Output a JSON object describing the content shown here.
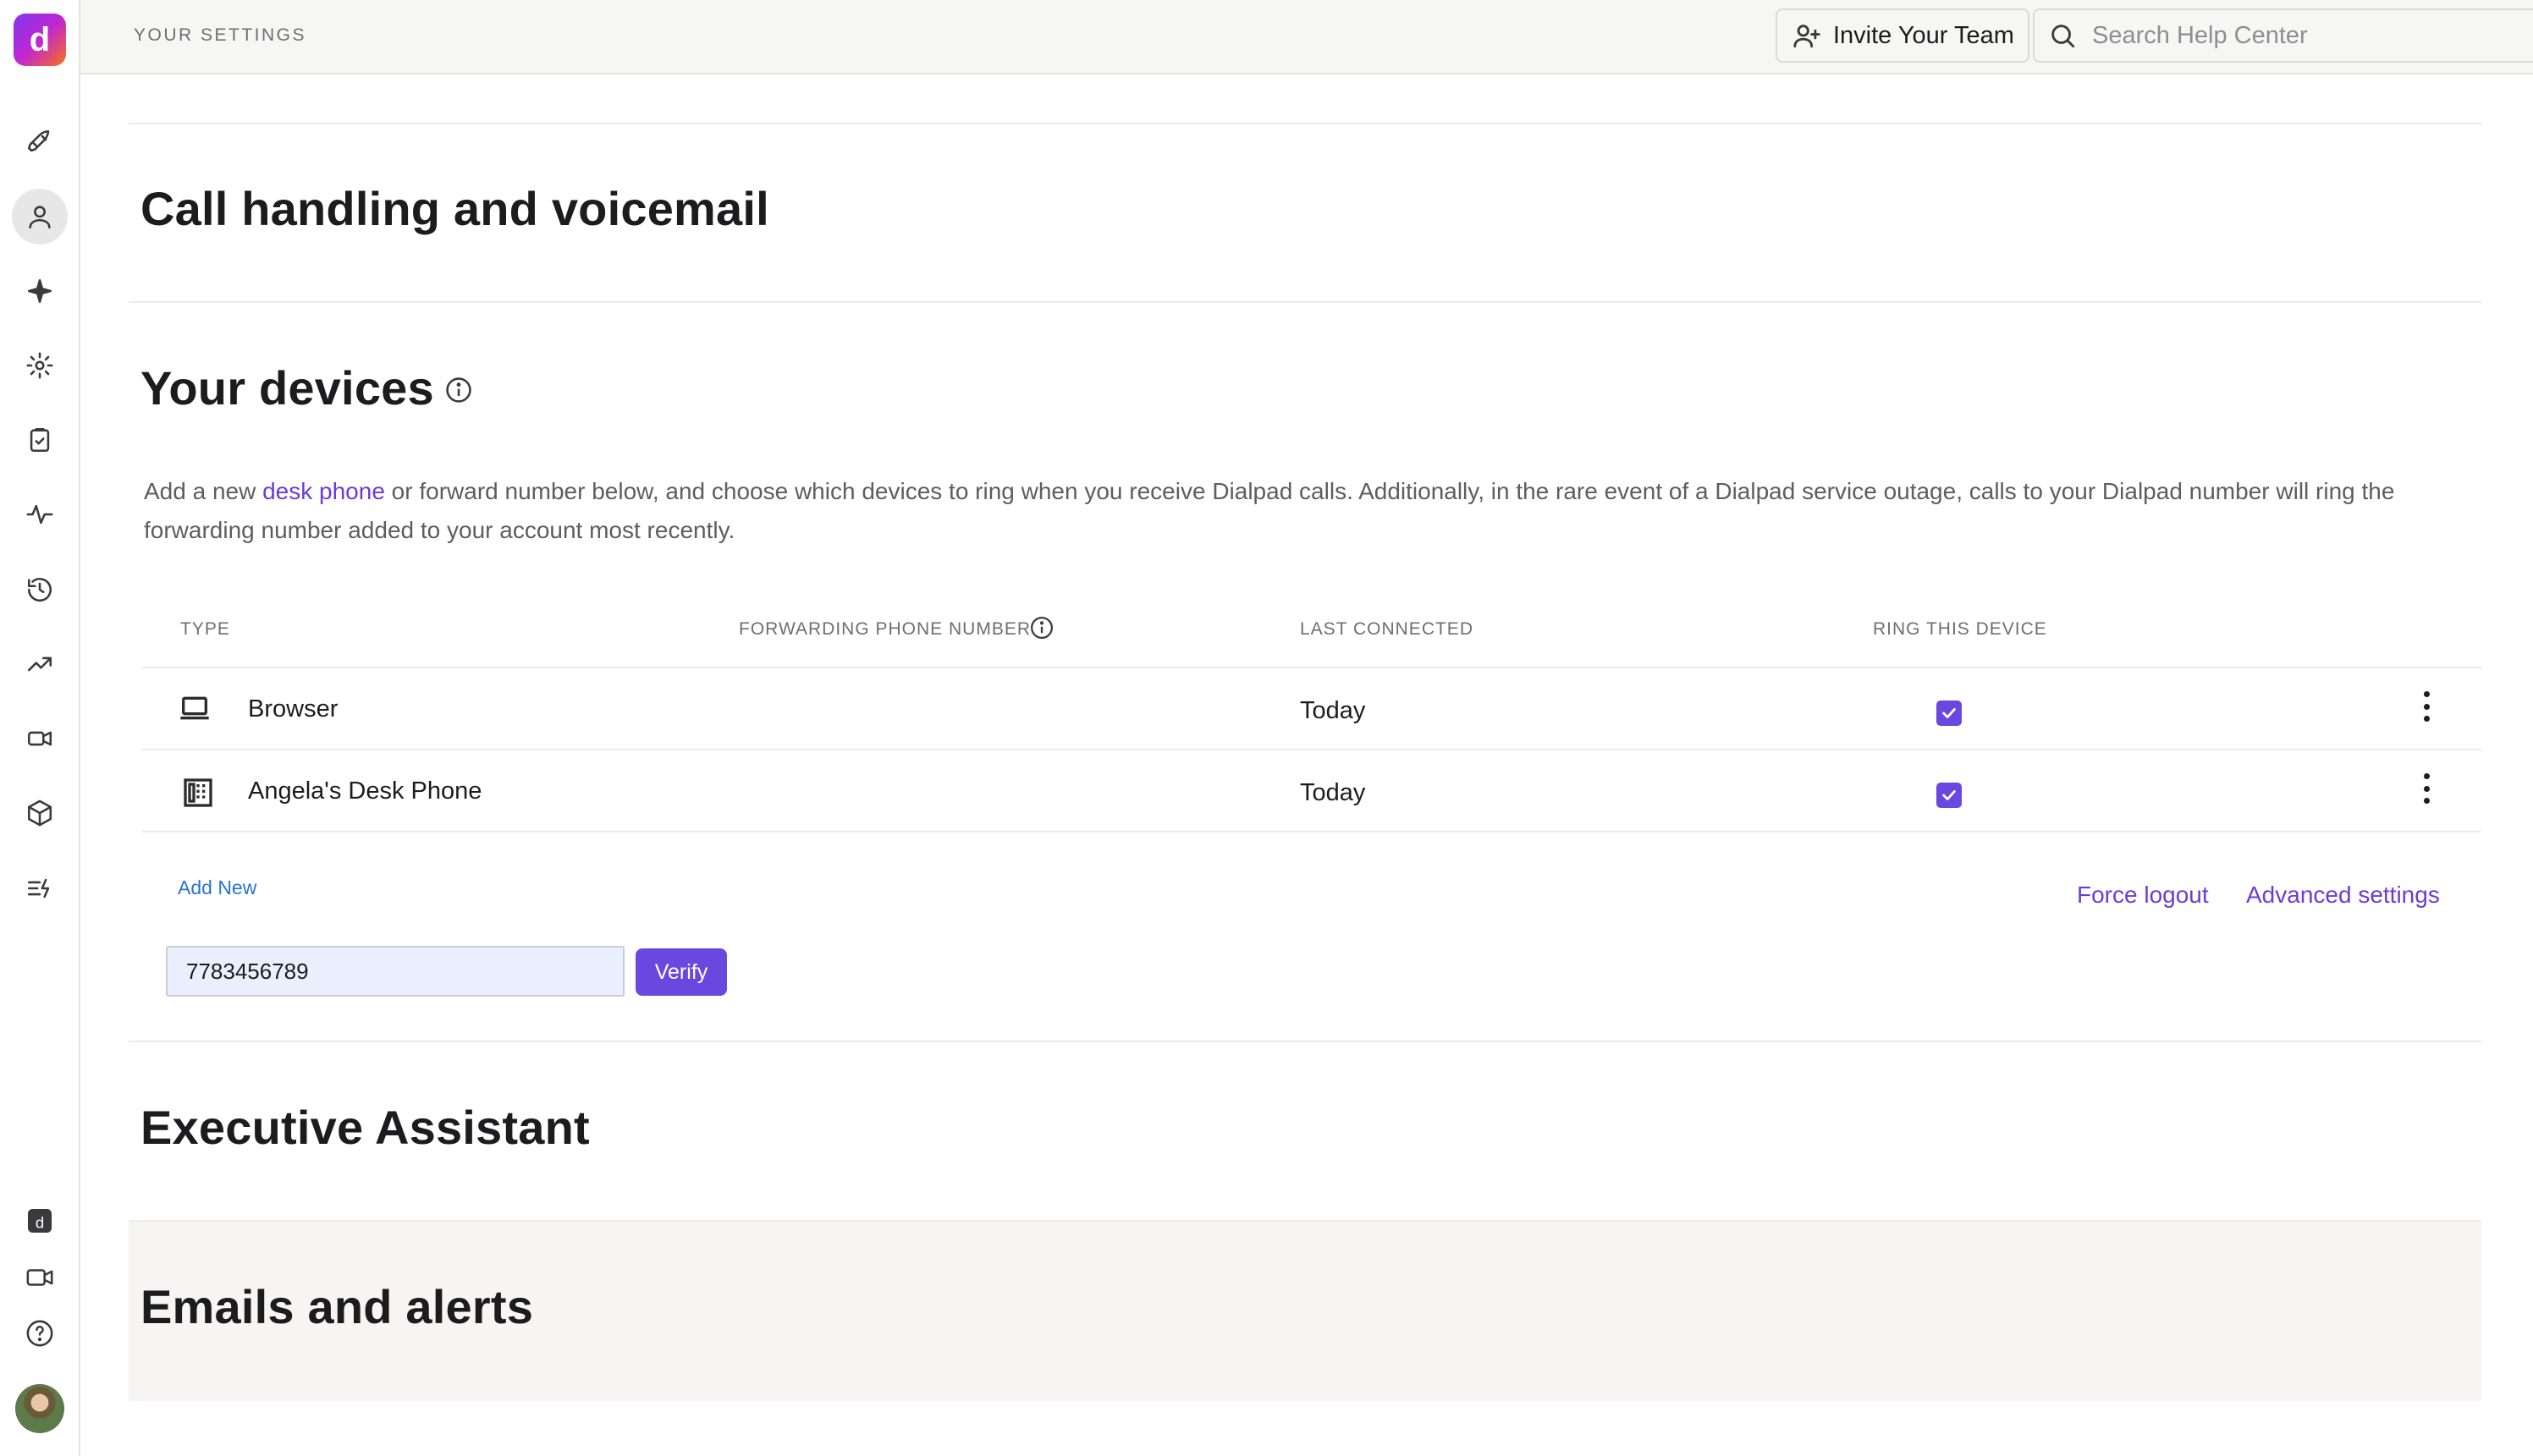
{
  "app": {
    "logo_letter": "d",
    "brand_gradient": [
      "#7c3aed",
      "#c026d3",
      "#f97316"
    ],
    "accent": "#6a48e0"
  },
  "sidebar": {
    "items": [
      {
        "name": "rocket-icon",
        "active": false
      },
      {
        "name": "user-icon",
        "active": true
      },
      {
        "name": "sparkle-icon",
        "active": false
      },
      {
        "name": "gear-icon",
        "active": false
      },
      {
        "name": "clipboard-icon",
        "active": false
      },
      {
        "name": "activity-icon",
        "active": false
      },
      {
        "name": "history-icon",
        "active": false
      },
      {
        "name": "trending-up-icon",
        "active": false
      },
      {
        "name": "video-camera-icon",
        "active": false
      },
      {
        "name": "box-icon",
        "active": false
      },
      {
        "name": "list-bolt-icon",
        "active": false
      }
    ],
    "bottom_items": [
      {
        "name": "dialpad-app-icon"
      },
      {
        "name": "video-icon"
      },
      {
        "name": "help-icon"
      },
      {
        "name": "avatar"
      }
    ]
  },
  "header": {
    "page_label": "YOUR SETTINGS",
    "invite_label": "Invite Your Team",
    "search_placeholder": "Search Help Center"
  },
  "sections": {
    "call_handling": "Call handling and voicemail",
    "devices": {
      "title": "Your devices",
      "description_pre": "Add a new ",
      "description_link": "desk phone",
      "description_post": " or forward number below, and choose which devices to ring when you receive Dialpad calls. Additionally, in the rare event of a Dialpad service outage, calls to your Dialpad number will ring the forwarding number added to your account most recently.",
      "columns": [
        "TYPE",
        "FORWARDING PHONE NUMBER",
        "LAST CONNECTED",
        "RING THIS DEVICE"
      ],
      "rows": [
        {
          "icon": "laptop-icon",
          "type": "Browser",
          "forwarding_number": "",
          "last_connected": "Today",
          "ring": true
        },
        {
          "icon": "desk-phone-icon",
          "type": "Angela's Desk Phone",
          "forwarding_number": "",
          "last_connected": "Today",
          "ring": true
        }
      ],
      "add_new_label": "Add New",
      "force_logout_label": "Force logout",
      "advanced_settings_label": "Advanced settings",
      "phone_input_value": "7783456789",
      "verify_label": "Verify"
    },
    "executive_assistant": "Executive Assistant",
    "emails_alerts": "Emails and alerts"
  }
}
